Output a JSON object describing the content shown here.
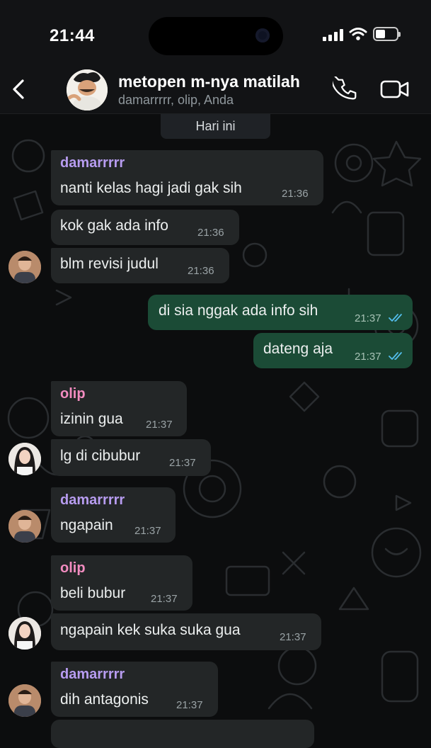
{
  "status_bar": {
    "time": "21:44"
  },
  "header": {
    "title": "metopen m-nya matilah",
    "members": "damarrrrr, olip, Anda"
  },
  "colors": {
    "damar": "#b79cf0",
    "olip": "#f28cc0",
    "outgoing_bubble": "#1b4b36",
    "incoming_bubble": "#232627",
    "read_ticks": "#53bdeb"
  },
  "chat": {
    "date_chip": "Hari ini",
    "messages": [
      {
        "sender": "damarrrrr",
        "text": "nanti kelas hagi jadi gak sih",
        "time": "21:36"
      },
      {
        "text": "kok gak ada info",
        "time": "21:36"
      },
      {
        "text": "blm revisi judul",
        "time": "21:36"
      },
      {
        "text": "di sia nggak ada info sih",
        "time": "21:37",
        "outgoing": true,
        "status": "read"
      },
      {
        "text": "dateng aja",
        "time": "21:37",
        "outgoing": true,
        "status": "read"
      },
      {
        "sender": "olip",
        "text": "izinin gua",
        "time": "21:37"
      },
      {
        "text": "lg di cibubur",
        "time": "21:37"
      },
      {
        "sender": "damarrrrr",
        "text": "ngapain",
        "time": "21:37"
      },
      {
        "sender": "olip",
        "text": "beli bubur",
        "time": "21:37"
      },
      {
        "text": "ngapain kek suka suka gua",
        "time": "21:37"
      },
      {
        "sender": "damarrrrr",
        "text": "dih antagonis",
        "time": "21:37"
      }
    ]
  },
  "icons": [
    "back-chevron-icon",
    "phone-icon",
    "video-camera-icon",
    "signal-icon",
    "wifi-icon",
    "battery-icon",
    "double-check-icon"
  ]
}
